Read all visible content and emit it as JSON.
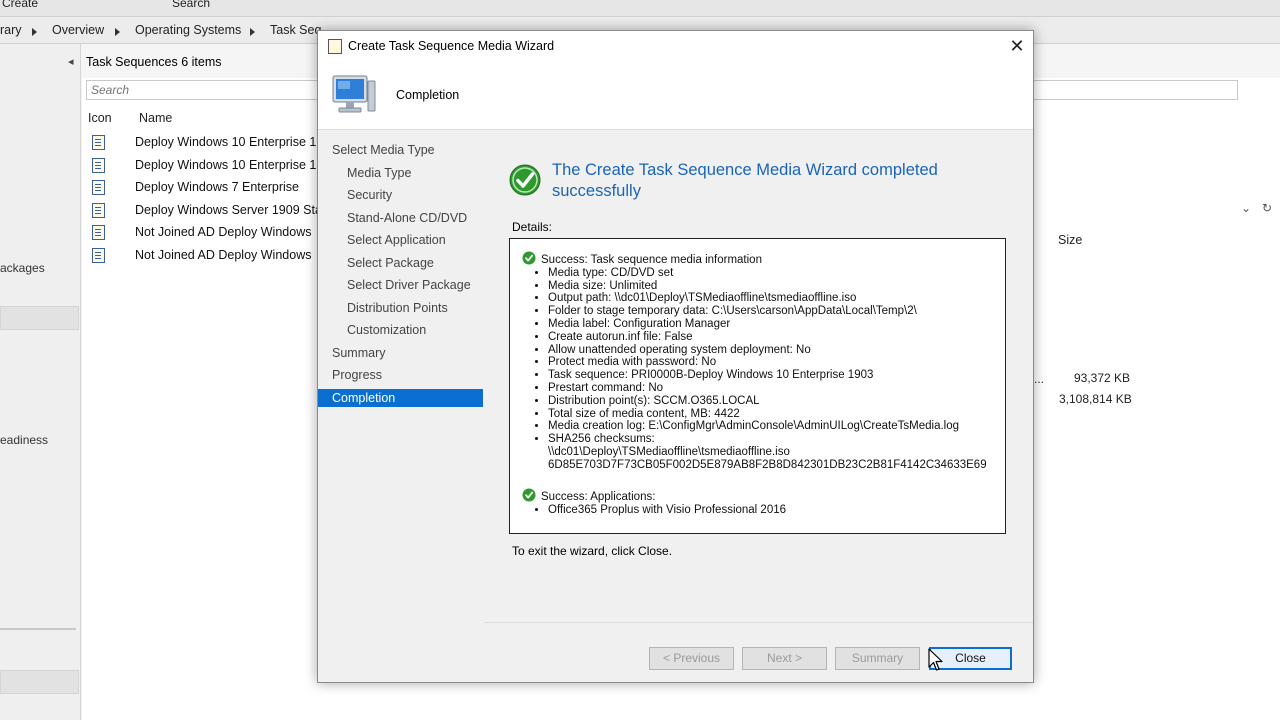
{
  "console": {
    "ribbon_labels": [
      "Create",
      "Search"
    ],
    "breadcrumb": [
      "rary",
      "Overview",
      "Operating Systems",
      "Task Seq"
    ],
    "leftnav_items": [
      "ackages",
      "eadiness"
    ],
    "pane_title": "Task Sequences 6 items",
    "search_placeholder": "Search",
    "columns": {
      "icon": "Icon",
      "name": "Name",
      "size": "Size"
    },
    "rows": [
      "Deploy Windows 10 Enterprise 1",
      "Deploy Windows 10 Enterprise 1",
      "Deploy Windows 7 Enterprise",
      "Deploy Windows Server 1909 Sta",
      "Not Joined AD Deploy Windows",
      "Not Joined AD Deploy Windows"
    ],
    "sizes": [
      "93,372 KB",
      "3,108,814 KB"
    ],
    "ellipsis": "..."
  },
  "dialog": {
    "title": "Create Task Sequence Media Wizard",
    "close_glyph": "✕",
    "step_title": "Completion",
    "nav": [
      {
        "label": "Select Media Type",
        "indent": false,
        "active": false
      },
      {
        "label": "Media Type",
        "indent": true,
        "active": false
      },
      {
        "label": "Security",
        "indent": true,
        "active": false
      },
      {
        "label": "Stand-Alone CD/DVD",
        "indent": true,
        "active": false
      },
      {
        "label": "Select Application",
        "indent": true,
        "active": false
      },
      {
        "label": "Select Package",
        "indent": true,
        "active": false
      },
      {
        "label": "Select Driver Package",
        "indent": true,
        "active": false
      },
      {
        "label": "Distribution Points",
        "indent": true,
        "active": false
      },
      {
        "label": "Customization",
        "indent": true,
        "active": false
      },
      {
        "label": "Summary",
        "indent": false,
        "active": false
      },
      {
        "label": "Progress",
        "indent": false,
        "active": false
      },
      {
        "label": "Completion",
        "indent": false,
        "active": true
      }
    ],
    "headline": "The Create Task Sequence Media Wizard completed successfully",
    "details_label": "Details:",
    "details": {
      "section1_title": "Success: Task sequence media information",
      "section1_items": [
        "Media type: CD/DVD set",
        "Media size: Unlimited",
        "Output path: \\\\dc01\\Deploy\\TSMediaoffline\\tsmediaoffline.iso",
        "Folder to stage temporary data: C:\\Users\\carson\\AppData\\Local\\Temp\\2\\",
        "Media label: Configuration Manager",
        "Create autorun.inf file: False",
        "Allow unattended operating system deployment: No",
        "Protect media with password: No",
        "Task sequence: PRI0000B-Deploy Windows 10 Enterprise 1903",
        "Prestart command: No",
        "Distribution point(s): SCCM.O365.LOCAL",
        "Total size of media content, MB:  4422",
        "Media creation log: E:\\ConfigMgr\\AdminConsole\\AdminUILog\\CreateTsMedia.log",
        "SHA256 checksums:\n\\\\dc01\\Deploy\\TSMediaoffline\\tsmediaoffline.iso\n6D85E703D7F73CB05F002D5E879AB8F2B8D842301DB23C2B81F4142C34633E69"
      ],
      "section2_title": "Success: Applications:",
      "section2_items": [
        "Office365 Proplus with Visio Professional 2016"
      ]
    },
    "exit_note": "To exit the wizard, click Close.",
    "buttons": {
      "previous": "< Previous",
      "next": "Next >",
      "summary": "Summary",
      "close": "Close"
    },
    "colors": {
      "accent": "#0b6fd1",
      "headline": "#1a64b8",
      "success": "#2e9a2e"
    }
  }
}
